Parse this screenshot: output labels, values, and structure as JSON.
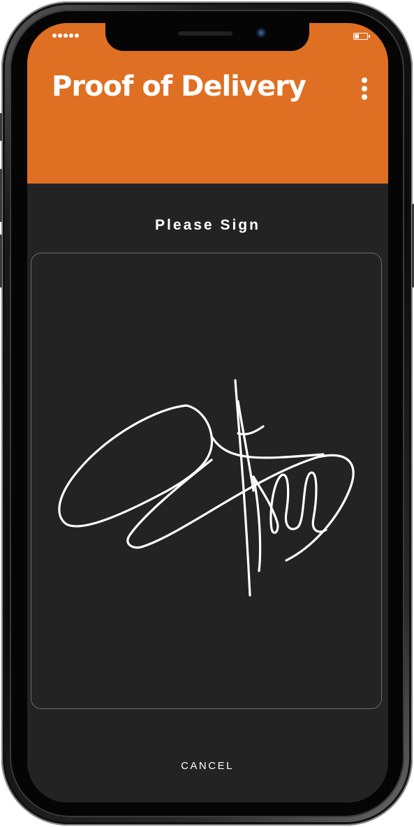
{
  "status_bar": {
    "signal_dots": 5,
    "battery_level": 0.35
  },
  "header": {
    "title": "Proof of Delivery",
    "menu_icon": "more-vertical-icon",
    "background_color": "#df6f22"
  },
  "main": {
    "prompt": "Please Sign",
    "signature_pad": {
      "has_signature": true,
      "stroke_color": "#ffffff"
    },
    "cancel_label": "CANCEL"
  },
  "colors": {
    "accent": "#df6f22",
    "background": "#232323",
    "pad_border": "#6b6b6b",
    "text": "#ffffff"
  }
}
